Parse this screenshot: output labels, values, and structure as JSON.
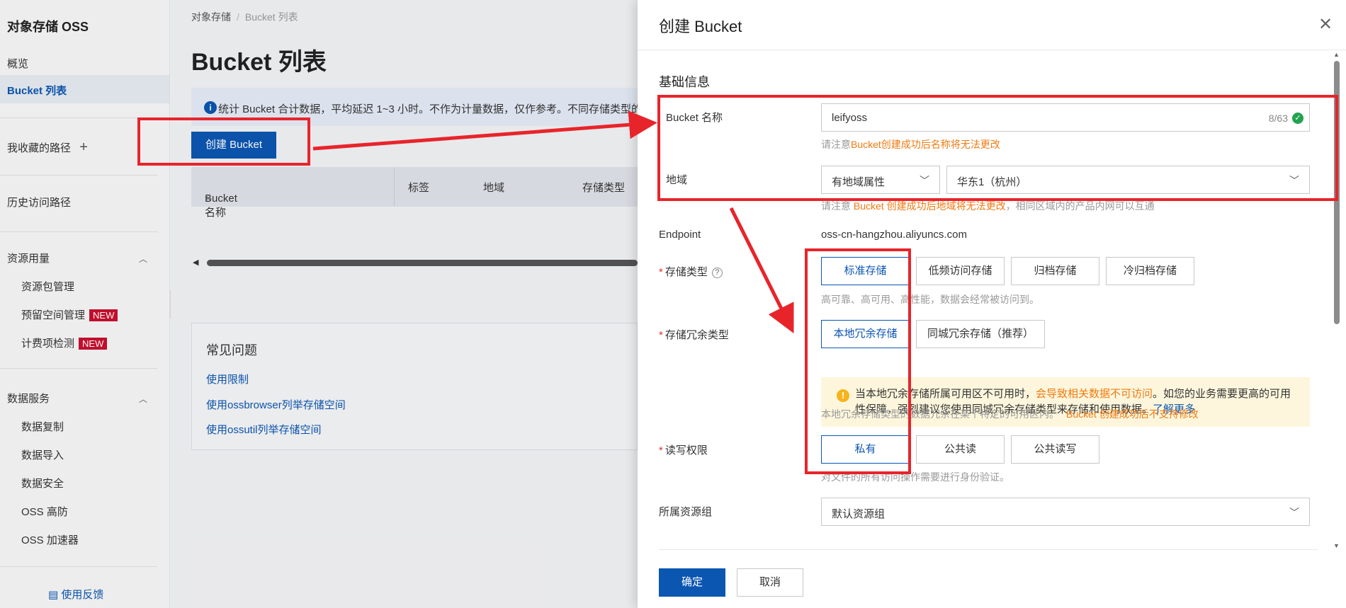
{
  "sidebar": {
    "title": "对象存储 OSS",
    "overview": "概览",
    "bucket_list": "Bucket 列表",
    "favorites": "我收藏的路径",
    "favorites_add": "+",
    "history": "历史访问路径",
    "resource_usage": "资源用量",
    "resource_items": [
      "资源包管理",
      "预留空间管理",
      "计费项检测"
    ],
    "new_badge": "NEW",
    "data_services": "数据服务",
    "data_items": [
      "数据复制",
      "数据导入",
      "数据安全",
      "OSS 高防",
      "OSS 加速器"
    ],
    "feedback": "使用反馈"
  },
  "main": {
    "breadcrumb": [
      "对象存储",
      "Bucket 列表"
    ],
    "title": "Bucket 列表",
    "info": "统计 Bucket 合计数据，平均延迟 1~3 小时。不作为计量数据，仅作参考。不同存储类型的",
    "create_button": "创建 Bucket",
    "columns": [
      "Bucket 名称",
      "标签",
      "地域",
      "存储类型"
    ],
    "faq_title": "常见问题",
    "faq_links": [
      "使用限制",
      "使用ossbrowser列举存储空间",
      "使用ossutil列举存储空间"
    ]
  },
  "drawer": {
    "title": "创建 Bucket",
    "section": "基础信息",
    "name_label": "Bucket 名称",
    "name_value": "leifyoss",
    "name_count": "8/63",
    "name_hint_prefix": "请注意",
    "name_hint_orange": "Bucket创建成功后名称将无法更改",
    "region_label": "地域",
    "region_attr": "有地域属性",
    "region_value": "华东1（杭州）",
    "region_hint_prefix": "请注意 ",
    "region_hint_orange": "Bucket 创建成功后地域将无法更改",
    "region_hint_suffix": "，相同区域内的产品内网可以互通",
    "endpoint_label": "Endpoint",
    "endpoint_value": "oss-cn-hangzhou.aliyuncs.com",
    "storage_label": "存储类型",
    "storage_options": [
      "标准存储",
      "低频访问存储",
      "归档存储",
      "冷归档存储"
    ],
    "storage_hint": "高可靠、高可用、高性能，数据会经常被访问到。",
    "redundancy_label": "存储冗余类型",
    "redundancy_options": [
      "本地冗余存储",
      "同城冗余存储（推荐）"
    ],
    "warn_prefix": "当本地冗余存储所属可用区不可用时，",
    "warn_orange": "会导致相关数据不可访问",
    "warn_suffix": "。如您的业务需要更高的可用性保障，强烈建议您使用同城冗余存储类型来存储和使用数据。",
    "warn_link": "了解更多",
    "redundancy_hint_prefix": "本地冗余存储类型的数据冗余在某个特定的可用区内。",
    "redundancy_hint_orange": "Bucket 创建成功后不支持修改",
    "acl_label": "读写权限",
    "acl_options": [
      "私有",
      "公共读",
      "公共读写"
    ],
    "acl_hint": "对文件的所有访问操作需要进行身份验证。",
    "rg_label": "所属资源组",
    "rg_value": "默认资源组",
    "ok": "确定",
    "cancel": "取消"
  },
  "colors": {
    "brand": "#0b56b1",
    "annotation": "#e8242b",
    "warning": "#f07a12"
  }
}
